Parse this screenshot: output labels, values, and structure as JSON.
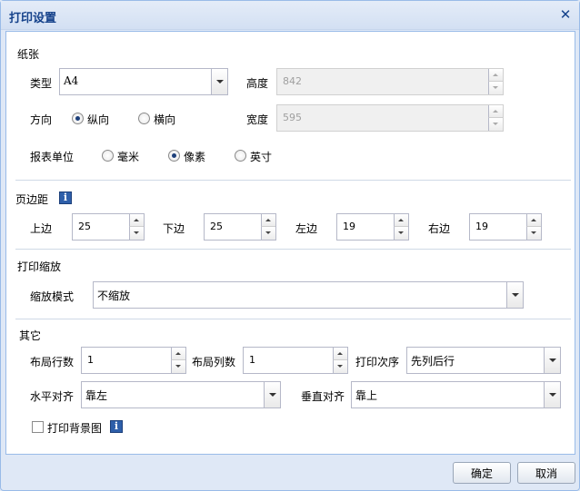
{
  "dialog": {
    "title": "打印设置"
  },
  "paper": {
    "section_title": "纸张",
    "type_label": "类型",
    "type_value": "A4",
    "height_label": "高度",
    "height_value": "842",
    "orientation_label": "方向",
    "portrait_label": "纵向",
    "landscape_label": "横向",
    "orientation_selected": "portrait",
    "width_label": "宽度",
    "width_value": "595",
    "unit_label": "报表单位",
    "unit_mm": "毫米",
    "unit_px": "像素",
    "unit_in": "英寸",
    "unit_selected": "px"
  },
  "margins": {
    "section_title": "页边距",
    "top_label": "上边",
    "top_value": "25",
    "bottom_label": "下边",
    "bottom_value": "25",
    "left_label": "左边",
    "left_value": "19",
    "right_label": "右边",
    "right_value": "19"
  },
  "scaling": {
    "section_title": "打印缩放",
    "mode_label": "缩放模式",
    "mode_value": "不缩放"
  },
  "other": {
    "section_title": "其它",
    "rows_label": "布局行数",
    "rows_value": "1",
    "cols_label": "布局列数",
    "cols_value": "1",
    "order_label": "打印次序",
    "order_value": "先列后行",
    "halign_label": "水平对齐",
    "halign_value": "靠左",
    "valign_label": "垂直对齐",
    "valign_value": "靠上",
    "print_bg_label": "打印背景图",
    "print_bg_checked": false
  },
  "footer": {
    "ok_label": "确定",
    "cancel_label": "取消"
  },
  "colors": {
    "title_text": "#15428b",
    "frame_bg": "#dfe8f6",
    "border": "#99bbe8"
  }
}
